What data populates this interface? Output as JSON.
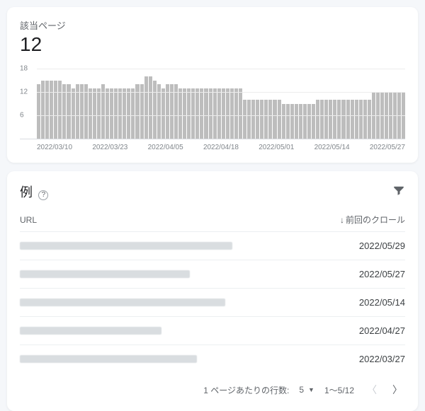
{
  "summary": {
    "title": "該当ページ",
    "value": "12"
  },
  "chart_data": {
    "type": "bar",
    "ylabel": "",
    "xlabel": "",
    "ylim": [
      0,
      18
    ],
    "y_ticks": [
      6,
      12,
      18
    ],
    "x_ticks": [
      "2022/03/10",
      "2022/03/23",
      "2022/04/05",
      "2022/04/18",
      "2022/05/01",
      "2022/05/14",
      "2022/05/27"
    ],
    "categories": [
      "2022/03/10",
      "2022/03/11",
      "2022/03/12",
      "2022/03/13",
      "2022/03/14",
      "2022/03/15",
      "2022/03/16",
      "2022/03/17",
      "2022/03/18",
      "2022/03/19",
      "2022/03/20",
      "2022/03/21",
      "2022/03/22",
      "2022/03/23",
      "2022/03/24",
      "2022/03/25",
      "2022/03/26",
      "2022/03/27",
      "2022/03/28",
      "2022/03/29",
      "2022/03/30",
      "2022/03/31",
      "2022/04/01",
      "2022/04/02",
      "2022/04/03",
      "2022/04/04",
      "2022/04/05",
      "2022/04/06",
      "2022/04/07",
      "2022/04/08",
      "2022/04/09",
      "2022/04/10",
      "2022/04/11",
      "2022/04/12",
      "2022/04/13",
      "2022/04/14",
      "2022/04/15",
      "2022/04/16",
      "2022/04/17",
      "2022/04/18",
      "2022/04/19",
      "2022/04/20",
      "2022/04/21",
      "2022/04/22",
      "2022/04/23",
      "2022/04/24",
      "2022/04/25",
      "2022/04/26",
      "2022/04/27",
      "2022/04/28",
      "2022/04/29",
      "2022/04/30",
      "2022/05/01",
      "2022/05/02",
      "2022/05/03",
      "2022/05/04",
      "2022/05/05",
      "2022/05/06",
      "2022/05/07",
      "2022/05/08",
      "2022/05/09",
      "2022/05/10",
      "2022/05/11",
      "2022/05/12",
      "2022/05/13",
      "2022/05/14",
      "2022/05/15",
      "2022/05/16",
      "2022/05/17",
      "2022/05/18",
      "2022/05/19",
      "2022/05/20",
      "2022/05/21",
      "2022/05/22",
      "2022/05/23",
      "2022/05/24",
      "2022/05/25",
      "2022/05/26",
      "2022/05/27",
      "2022/05/28",
      "2022/05/29",
      "2022/05/30",
      "2022/05/31",
      "2022/06/01",
      "2022/06/02",
      "2022/06/03"
    ],
    "values": [
      14,
      15,
      15,
      15,
      15,
      15,
      14,
      14,
      13,
      14,
      14,
      14,
      13,
      13,
      13,
      14,
      13,
      13,
      13,
      13,
      13,
      13,
      13,
      14,
      14,
      16,
      16,
      15,
      14,
      13,
      14,
      14,
      14,
      13,
      13,
      13,
      13,
      13,
      13,
      13,
      13,
      13,
      13,
      13,
      13,
      13,
      13,
      13,
      10,
      10,
      10,
      10,
      10,
      10,
      10,
      10,
      10,
      9,
      9,
      9,
      9,
      9,
      9,
      9,
      9,
      10,
      10,
      10,
      10,
      10,
      10,
      10,
      10,
      10,
      10,
      10,
      10,
      10,
      12,
      12,
      12,
      12,
      12,
      12,
      12,
      12
    ]
  },
  "table": {
    "title": "例",
    "columns": {
      "url": "URL",
      "crawl": "前回のクロール"
    },
    "rows": [
      {
        "url_width": 300,
        "date": "2022/05/29"
      },
      {
        "url_width": 240,
        "date": "2022/05/27"
      },
      {
        "url_width": 290,
        "date": "2022/05/14"
      },
      {
        "url_width": 200,
        "date": "2022/04/27"
      },
      {
        "url_width": 250,
        "date": "2022/03/27"
      }
    ]
  },
  "pagination": {
    "rows_per_page_label": "1 ページあたりの行数:",
    "rows_per_page_value": "5",
    "range": "1～5/12"
  }
}
